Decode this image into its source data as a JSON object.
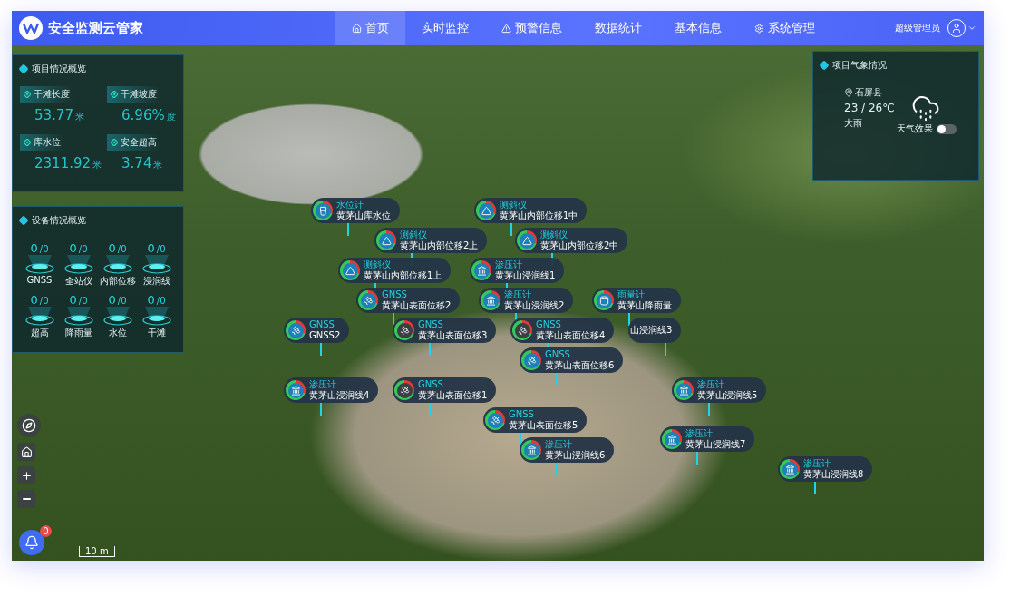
{
  "header": {
    "title": "安全监测云管家",
    "nav": [
      {
        "label": "首页",
        "selected": true
      },
      {
        "label": "实时监控",
        "selected": false
      },
      {
        "label": "预警信息",
        "selected": false
      },
      {
        "label": "数据统计",
        "selected": false
      },
      {
        "label": "基本信息",
        "selected": false
      },
      {
        "label": "系统管理",
        "selected": false
      }
    ],
    "user": "超级管理员"
  },
  "project_overview": {
    "title": "项目情况概览",
    "stats": [
      {
        "label": "干滩长度",
        "value": "53.77",
        "unit": "米"
      },
      {
        "label": "干滩坡度",
        "value": "6.96%",
        "unit": "度"
      },
      {
        "label": "库水位",
        "value": "2311.92",
        "unit": "米"
      },
      {
        "label": "安全超高",
        "value": "3.74",
        "unit": "米"
      }
    ]
  },
  "device_overview": {
    "title": "设备情况概览",
    "devices": [
      {
        "count": "0",
        "total": "/0",
        "label": "GNSS"
      },
      {
        "count": "0",
        "total": "/0",
        "label": "全站仪"
      },
      {
        "count": "0",
        "total": "/0",
        "label": "内部位移"
      },
      {
        "count": "0",
        "total": "/0",
        "label": "浸润线"
      },
      {
        "count": "0",
        "total": "/0",
        "label": "超高"
      },
      {
        "count": "0",
        "total": "/0",
        "label": "降雨量"
      },
      {
        "count": "0",
        "total": "/0",
        "label": "水位"
      },
      {
        "count": "0",
        "total": "/0",
        "label": "干滩"
      }
    ]
  },
  "weather": {
    "title": "项目气象情况",
    "location": "石屏县",
    "temperature": "23 / 26℃",
    "condition": "大雨",
    "effect_label": "天气效果",
    "effect_on": false
  },
  "markers": [
    {
      "kind": "water",
      "type": "水位计",
      "name": "黄茅山库水位"
    },
    {
      "kind": "inclinometer",
      "type": "测斜仪",
      "name": "黄茅山内部位移1中"
    },
    {
      "kind": "inclinometer",
      "type": "测斜仪",
      "name": "黄茅山内部位移2上"
    },
    {
      "kind": "inclinometer",
      "type": "测斜仪",
      "name": "黄茅山内部位移2中"
    },
    {
      "kind": "inclinometer",
      "type": "测斜仪",
      "name": "黄茅山内部位移1上"
    },
    {
      "kind": "piezometer",
      "type": "渗压计",
      "name": "黄茅山浸润线1"
    },
    {
      "kind": "gnss",
      "type": "GNSS",
      "name": "黄茅山表面位移2",
      "online": true
    },
    {
      "kind": "gnss",
      "type": "GNSS",
      "name": "GNSS2",
      "online": true
    },
    {
      "kind": "gnss",
      "type": "GNSS",
      "name": "黄茅山表面位移3",
      "online": false
    },
    {
      "kind": "piezometer",
      "type": "渗压计",
      "name": "黄茅山浸润线2"
    },
    {
      "kind": "rain",
      "type": "雨量计",
      "name": "黄茅山降雨量"
    },
    {
      "kind": "gnss",
      "type": "GNSS",
      "name": "黄茅山表面位移4",
      "online": false
    },
    {
      "kind": "gnss",
      "type": "GNSS",
      "name": "黄茅山表面位移6",
      "online": true
    },
    {
      "name": "山浸润线3"
    },
    {
      "kind": "piezometer",
      "type": "渗压计",
      "name": "黄茅山浸润线4"
    },
    {
      "kind": "gnss",
      "type": "GNSS",
      "name": "黄茅山表面位移1",
      "online": false
    },
    {
      "kind": "gnss",
      "type": "GNSS",
      "name": "黄茅山表面位移5",
      "online": true
    },
    {
      "kind": "piezometer",
      "type": "渗压计",
      "name": "黄茅山浸润线6"
    },
    {
      "kind": "piezometer",
      "type": "渗压计",
      "name": "黄茅山浸润线5"
    },
    {
      "kind": "piezometer",
      "type": "渗压计",
      "name": "黄茅山浸润线7"
    },
    {
      "kind": "piezometer",
      "type": "渗压计",
      "name": "黄茅山浸润线8"
    }
  ],
  "alerts": {
    "badge": "0"
  },
  "scale": "10 m"
}
